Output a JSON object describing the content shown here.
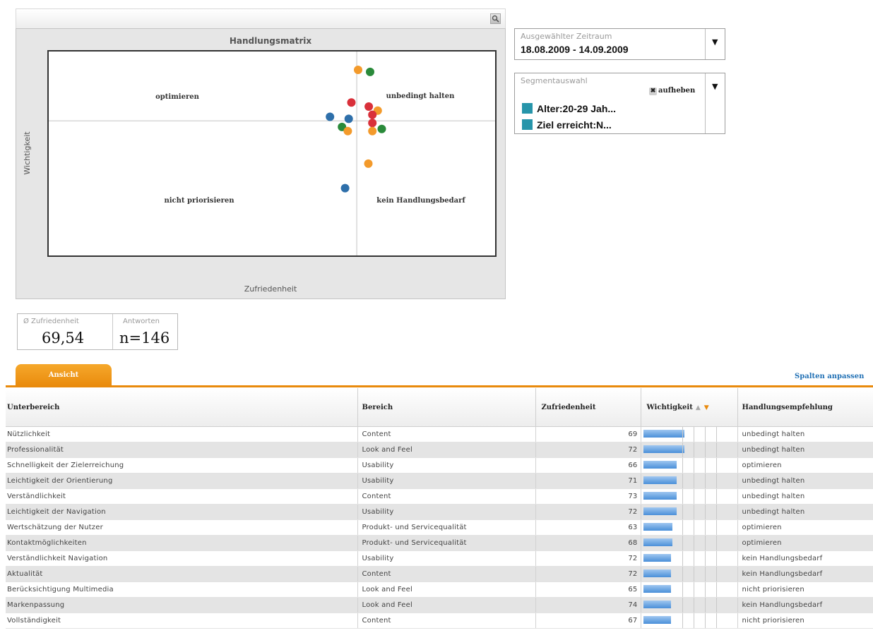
{
  "matrix": {
    "title": "Handlungsmatrix",
    "xlabel": "Zufriedenheit",
    "ylabel": "Wichtigkeit",
    "quadrants": {
      "top_left": "optimieren",
      "top_right": "unbedingt halten",
      "bottom_left": "nicht priorisieren",
      "bottom_right": "kein Handlungsbedarf"
    }
  },
  "chart_data": {
    "type": "scatter",
    "title": "Handlungsmatrix",
    "xlabel": "Zufriedenheit",
    "ylabel": "Wichtigkeit",
    "xlim": [
      0,
      100
    ],
    "ylim": [
      0,
      100
    ],
    "midlines": {
      "x": 69,
      "y": 66
    },
    "points": [
      {
        "x": 69.3,
        "y": 91,
        "color": "#f39a2b"
      },
      {
        "x": 72,
        "y": 90,
        "color": "#2a8a3a"
      },
      {
        "x": 67.8,
        "y": 75,
        "color": "#d9303a"
      },
      {
        "x": 71.7,
        "y": 73,
        "color": "#d9303a"
      },
      {
        "x": 73.7,
        "y": 71,
        "color": "#f39a2b"
      },
      {
        "x": 72.5,
        "y": 69,
        "color": "#d9303a"
      },
      {
        "x": 63,
        "y": 68,
        "color": "#2e6faa"
      },
      {
        "x": 67.2,
        "y": 67,
        "color": "#2e6faa"
      },
      {
        "x": 72.5,
        "y": 65,
        "color": "#d9303a"
      },
      {
        "x": 65.7,
        "y": 63,
        "color": "#2a8a3a"
      },
      {
        "x": 72.5,
        "y": 61,
        "color": "#f39a2b"
      },
      {
        "x": 74.6,
        "y": 62,
        "color": "#2a8a3a"
      },
      {
        "x": 67,
        "y": 61,
        "color": "#f39a2b"
      },
      {
        "x": 71.6,
        "y": 45,
        "color": "#f39a2b"
      },
      {
        "x": 66.4,
        "y": 33,
        "color": "#2e6faa"
      }
    ]
  },
  "period": {
    "caption": "Ausgewählter Zeitraum",
    "value": "18.08.2009 - 14.09.2009"
  },
  "segment": {
    "caption": "Segmentauswahl",
    "clear_label": "aufheben",
    "items": [
      "Alter:20-29 Jah...",
      "Ziel erreicht:N..."
    ]
  },
  "stats": {
    "avg_caption": "Ø Zufriedenheit",
    "avg_value": "69,54",
    "answers_caption": "Antworten",
    "answers_value": "n=146"
  },
  "tabs": {
    "active": "Ansicht"
  },
  "columns_link": "Spalten anpassen",
  "table": {
    "headers": [
      "Unterbereich",
      "Bereich",
      "Zufriedenheit",
      "Wichtigkeit",
      "Handlungsempfehlung"
    ],
    "rows": [
      {
        "sub": "Nützlichkeit",
        "area": "Content",
        "sat": "69",
        "imp": 0.66,
        "rec": "unbedingt halten"
      },
      {
        "sub": "Professionalität",
        "area": "Look and Feel",
        "sat": "72",
        "imp": 0.66,
        "rec": "unbedingt halten"
      },
      {
        "sub": "Schnelligkeit der Zielerreichung",
        "area": "Usability",
        "sat": "66",
        "imp": 0.53,
        "rec": "optimieren"
      },
      {
        "sub": "Leichtigkeit der Orientierung",
        "area": "Usability",
        "sat": "71",
        "imp": 0.53,
        "rec": "unbedingt halten"
      },
      {
        "sub": "Verständlichkeit",
        "area": "Content",
        "sat": "73",
        "imp": 0.53,
        "rec": "unbedingt halten"
      },
      {
        "sub": "Leichtigkeit der Navigation",
        "area": "Usability",
        "sat": "72",
        "imp": 0.53,
        "rec": "unbedingt halten"
      },
      {
        "sub": "Wertschätzung der Nutzer",
        "area": "Produkt- und Servicequalität",
        "sat": "63",
        "imp": 0.47,
        "rec": "optimieren"
      },
      {
        "sub": "Kontaktmöglichkeiten",
        "area": "Produkt- und Servicequalität",
        "sat": "68",
        "imp": 0.47,
        "rec": "optimieren"
      },
      {
        "sub": "Verständlichkeit Navigation",
        "area": "Usability",
        "sat": "72",
        "imp": 0.44,
        "rec": "kein Handlungsbedarf"
      },
      {
        "sub": "Aktualität",
        "area": "Content",
        "sat": "72",
        "imp": 0.44,
        "rec": "kein Handlungsbedarf"
      },
      {
        "sub": "Berücksichtigung Multimedia",
        "area": "Look and Feel",
        "sat": "65",
        "imp": 0.44,
        "rec": "nicht priorisieren"
      },
      {
        "sub": "Markenpassung",
        "area": "Look and Feel",
        "sat": "74",
        "imp": 0.44,
        "rec": "kein Handlungsbedarf"
      },
      {
        "sub": "Vollständigkeit",
        "area": "Content",
        "sat": "67",
        "imp": 0.44,
        "rec": "nicht priorisieren"
      }
    ]
  }
}
